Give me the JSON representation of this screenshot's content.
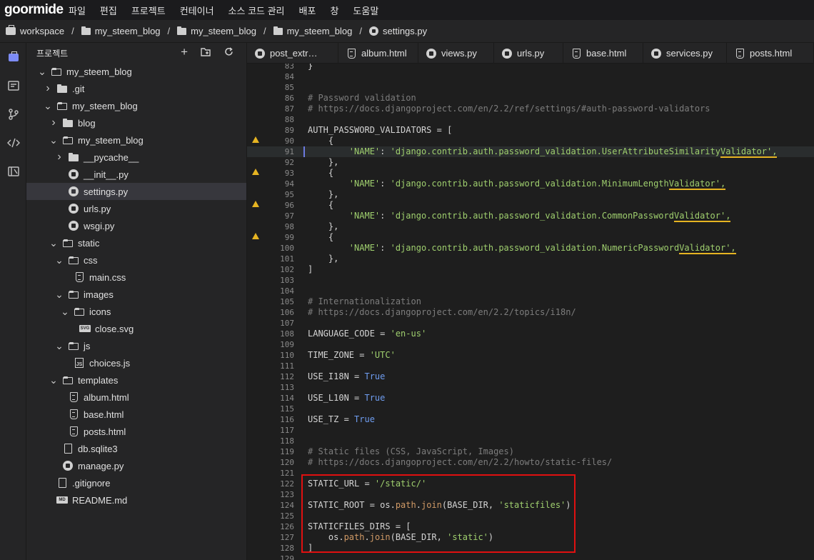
{
  "menubar": {
    "logo": "goormide",
    "items": [
      "파일",
      "편집",
      "프로젝트",
      "컨테이너",
      "소스 코드 관리",
      "배포",
      "창",
      "도움말"
    ]
  },
  "breadcrumb": [
    "workspace",
    "my_steem_blog",
    "my_steem_blog",
    "my_steem_blog",
    "settings.py"
  ],
  "sidebar": {
    "title": "프로젝트",
    "actions": [
      "add-file",
      "add-folder",
      "refresh"
    ],
    "tree": [
      {
        "label": "my_steem_blog",
        "depth": 0,
        "type": "folder",
        "open": true
      },
      {
        "label": ".git",
        "depth": 1,
        "type": "folder",
        "open": false
      },
      {
        "label": "my_steem_blog",
        "depth": 1,
        "type": "folder",
        "open": true
      },
      {
        "label": "blog",
        "depth": 2,
        "type": "folder",
        "open": false
      },
      {
        "label": "my_steem_blog",
        "depth": 2,
        "type": "folder",
        "open": true
      },
      {
        "label": "__pycache__",
        "depth": 3,
        "type": "folder",
        "open": false
      },
      {
        "label": "__init__.py",
        "depth": 3,
        "type": "py"
      },
      {
        "label": "settings.py",
        "depth": 3,
        "type": "py",
        "selected": true
      },
      {
        "label": "urls.py",
        "depth": 3,
        "type": "py"
      },
      {
        "label": "wsgi.py",
        "depth": 3,
        "type": "py"
      },
      {
        "label": "static",
        "depth": 2,
        "type": "folder",
        "open": true
      },
      {
        "label": "css",
        "depth": 3,
        "type": "folder",
        "open": true
      },
      {
        "label": "main.css",
        "depth": 4,
        "type": "html"
      },
      {
        "label": "images",
        "depth": 3,
        "type": "folder",
        "open": true
      },
      {
        "label": "icons",
        "depth": 4,
        "type": "folder",
        "open": true
      },
      {
        "label": "close.svg",
        "depth": 5,
        "type": "svg"
      },
      {
        "label": "js",
        "depth": 3,
        "type": "folder",
        "open": true
      },
      {
        "label": "choices.js",
        "depth": 4,
        "type": "js"
      },
      {
        "label": "templates",
        "depth": 2,
        "type": "folder",
        "open": true
      },
      {
        "label": "album.html",
        "depth": 3,
        "type": "html"
      },
      {
        "label": "base.html",
        "depth": 3,
        "type": "html"
      },
      {
        "label": "posts.html",
        "depth": 3,
        "type": "html"
      },
      {
        "label": "db.sqlite3",
        "depth": 2,
        "type": "doc"
      },
      {
        "label": "manage.py",
        "depth": 2,
        "type": "py"
      },
      {
        "label": ".gitignore",
        "depth": 1,
        "type": "doc"
      },
      {
        "label": "README.md",
        "depth": 1,
        "type": "md"
      }
    ]
  },
  "tabs": [
    {
      "label": "post_extr…",
      "type": "py"
    },
    {
      "label": "album.html",
      "type": "html"
    },
    {
      "label": "views.py",
      "type": "py"
    },
    {
      "label": "urls.py",
      "type": "py"
    },
    {
      "label": "base.html",
      "type": "html"
    },
    {
      "label": "services.py",
      "type": "py"
    },
    {
      "label": "posts.html",
      "type": "html"
    }
  ],
  "editor": {
    "first_line": 83,
    "lines": [
      [
        [
          "c-plain",
          "}"
        ]
      ],
      [],
      [],
      [
        [
          "c-cmt",
          "# Password validation"
        ]
      ],
      [
        [
          "c-cmt",
          "# https://docs.djangoproject.com/en/2.2/ref/settings/#auth-password-validators"
        ]
      ],
      [],
      [
        [
          "c-plain",
          "AUTH_PASSWORD_VALIDATORS = ["
        ]
      ],
      [
        [
          "c-plain",
          "    {"
        ]
      ],
      [
        [
          "c-plain",
          "        "
        ],
        [
          "c-str",
          "'NAME'"
        ],
        [
          "c-plain",
          ": "
        ],
        [
          "c-str",
          "'django.contrib.auth.password_validation.UserAttributeSimilarity"
        ],
        [
          "c-str squig",
          "Validator',"
        ]
      ],
      [
        [
          "c-plain",
          "    },"
        ]
      ],
      [
        [
          "c-plain",
          "    {"
        ]
      ],
      [
        [
          "c-plain",
          "        "
        ],
        [
          "c-str",
          "'NAME'"
        ],
        [
          "c-plain",
          ": "
        ],
        [
          "c-str",
          "'django.contrib.auth.password_validation.MinimumLength"
        ],
        [
          "c-str squig",
          "Validator',"
        ]
      ],
      [
        [
          "c-plain",
          "    },"
        ]
      ],
      [
        [
          "c-plain",
          "    {"
        ]
      ],
      [
        [
          "c-plain",
          "        "
        ],
        [
          "c-str",
          "'NAME'"
        ],
        [
          "c-plain",
          ": "
        ],
        [
          "c-str",
          "'django.contrib.auth.password_validation.CommonPassword"
        ],
        [
          "c-str squig",
          "Validator',"
        ]
      ],
      [
        [
          "c-plain",
          "    },"
        ]
      ],
      [
        [
          "c-plain",
          "    {"
        ]
      ],
      [
        [
          "c-plain",
          "        "
        ],
        [
          "c-str",
          "'NAME'"
        ],
        [
          "c-plain",
          ": "
        ],
        [
          "c-str",
          "'django.contrib.auth.password_validation.NumericPassword"
        ],
        [
          "c-str squig",
          "Validator',"
        ]
      ],
      [
        [
          "c-plain",
          "    },"
        ]
      ],
      [
        [
          "c-plain",
          "]"
        ]
      ],
      [],
      [],
      [
        [
          "c-cmt",
          "# Internationalization"
        ]
      ],
      [
        [
          "c-cmt",
          "# https://docs.djangoproject.com/en/2.2/topics/i18n/"
        ]
      ],
      [],
      [
        [
          "c-plain",
          "LANGUAGE_CODE = "
        ],
        [
          "c-str",
          "'en-us'"
        ]
      ],
      [],
      [
        [
          "c-plain",
          "TIME_ZONE = "
        ],
        [
          "c-str",
          "'UTC'"
        ]
      ],
      [],
      [
        [
          "c-plain",
          "USE_I18N = "
        ],
        [
          "c-kw",
          "True"
        ]
      ],
      [],
      [
        [
          "c-plain",
          "USE_L10N = "
        ],
        [
          "c-kw",
          "True"
        ]
      ],
      [],
      [
        [
          "c-plain",
          "USE_TZ = "
        ],
        [
          "c-kw",
          "True"
        ]
      ],
      [],
      [],
      [
        [
          "c-cmt",
          "# Static files (CSS, JavaScript, Images)"
        ]
      ],
      [
        [
          "c-cmt",
          "# https://docs.djangoproject.com/en/2.2/howto/static-files/"
        ]
      ],
      [],
      [
        [
          "c-plain",
          "STATIC_URL = "
        ],
        [
          "c-str",
          "'/static/'"
        ]
      ],
      [],
      [
        [
          "c-plain",
          "STATIC_ROOT = os."
        ],
        [
          "c-fn",
          "path"
        ],
        [
          "c-plain",
          "."
        ],
        [
          "c-fn",
          "join"
        ],
        [
          "c-plain",
          "(BASE_DIR, "
        ],
        [
          "c-str",
          "'staticfiles'"
        ],
        [
          "c-plain",
          ")"
        ]
      ],
      [],
      [
        [
          "c-plain",
          "STATICFILES_DIRS = ["
        ]
      ],
      [
        [
          "c-plain",
          "    os."
        ],
        [
          "c-fn",
          "path"
        ],
        [
          "c-plain",
          "."
        ],
        [
          "c-fn",
          "join"
        ],
        [
          "c-plain",
          "(BASE_DIR, "
        ],
        [
          "c-str",
          "'static'"
        ],
        [
          "c-plain",
          ")"
        ]
      ],
      [
        [
          "c-plain",
          "]"
        ]
      ],
      []
    ],
    "warning_lines": [
      90,
      93,
      96,
      99
    ],
    "cursor_line": 91
  }
}
